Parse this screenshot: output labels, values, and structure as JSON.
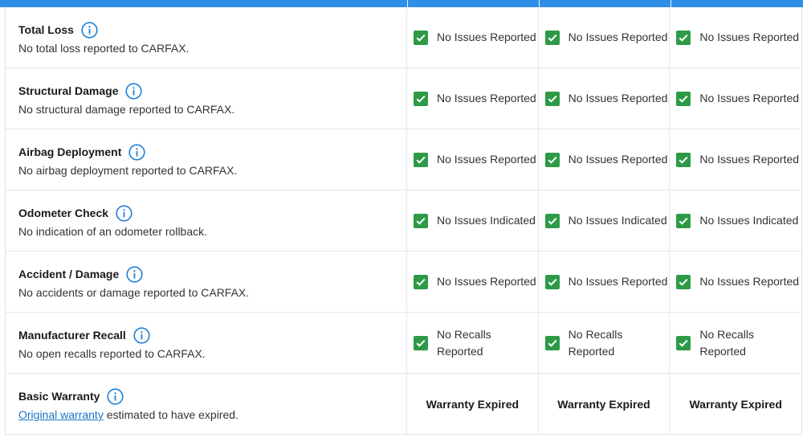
{
  "colors": {
    "header_bar": "#2f8fe8",
    "check": "#2e9a47",
    "link": "#1a73c8"
  },
  "rows": [
    {
      "title": "Total Loss",
      "desc": "No total loss reported to CARFAX.",
      "values": [
        "No Issues Reported",
        "No Issues Reported",
        "No Issues Reported"
      ]
    },
    {
      "title": "Structural Damage",
      "desc": "No structural damage reported to CARFAX.",
      "values": [
        "No Issues Reported",
        "No Issues Reported",
        "No Issues Reported"
      ]
    },
    {
      "title": "Airbag Deployment",
      "desc": "No airbag deployment reported to CARFAX.",
      "values": [
        "No Issues Reported",
        "No Issues Reported",
        "No Issues Reported"
      ]
    },
    {
      "title": "Odometer Check",
      "desc": "No indication of an odometer rollback.",
      "values": [
        "No Issues Indicated",
        "No Issues Indicated",
        "No Issues Indicated"
      ]
    },
    {
      "title": "Accident / Damage",
      "desc": "No accidents or damage reported to CARFAX.",
      "values": [
        "No Issues Reported",
        "No Issues Reported",
        "No Issues Reported"
      ]
    },
    {
      "title": "Manufacturer Recall",
      "desc": "No open recalls reported to CARFAX.",
      "values": [
        "No Recalls Reported",
        "No Recalls Reported",
        "No Recalls Reported"
      ]
    },
    {
      "title": "Basic Warranty",
      "desc_link": "Original warranty",
      "desc_rest": " estimated to have expired.",
      "values": [
        "Warranty Expired",
        "Warranty Expired",
        "Warranty Expired"
      ]
    }
  ]
}
